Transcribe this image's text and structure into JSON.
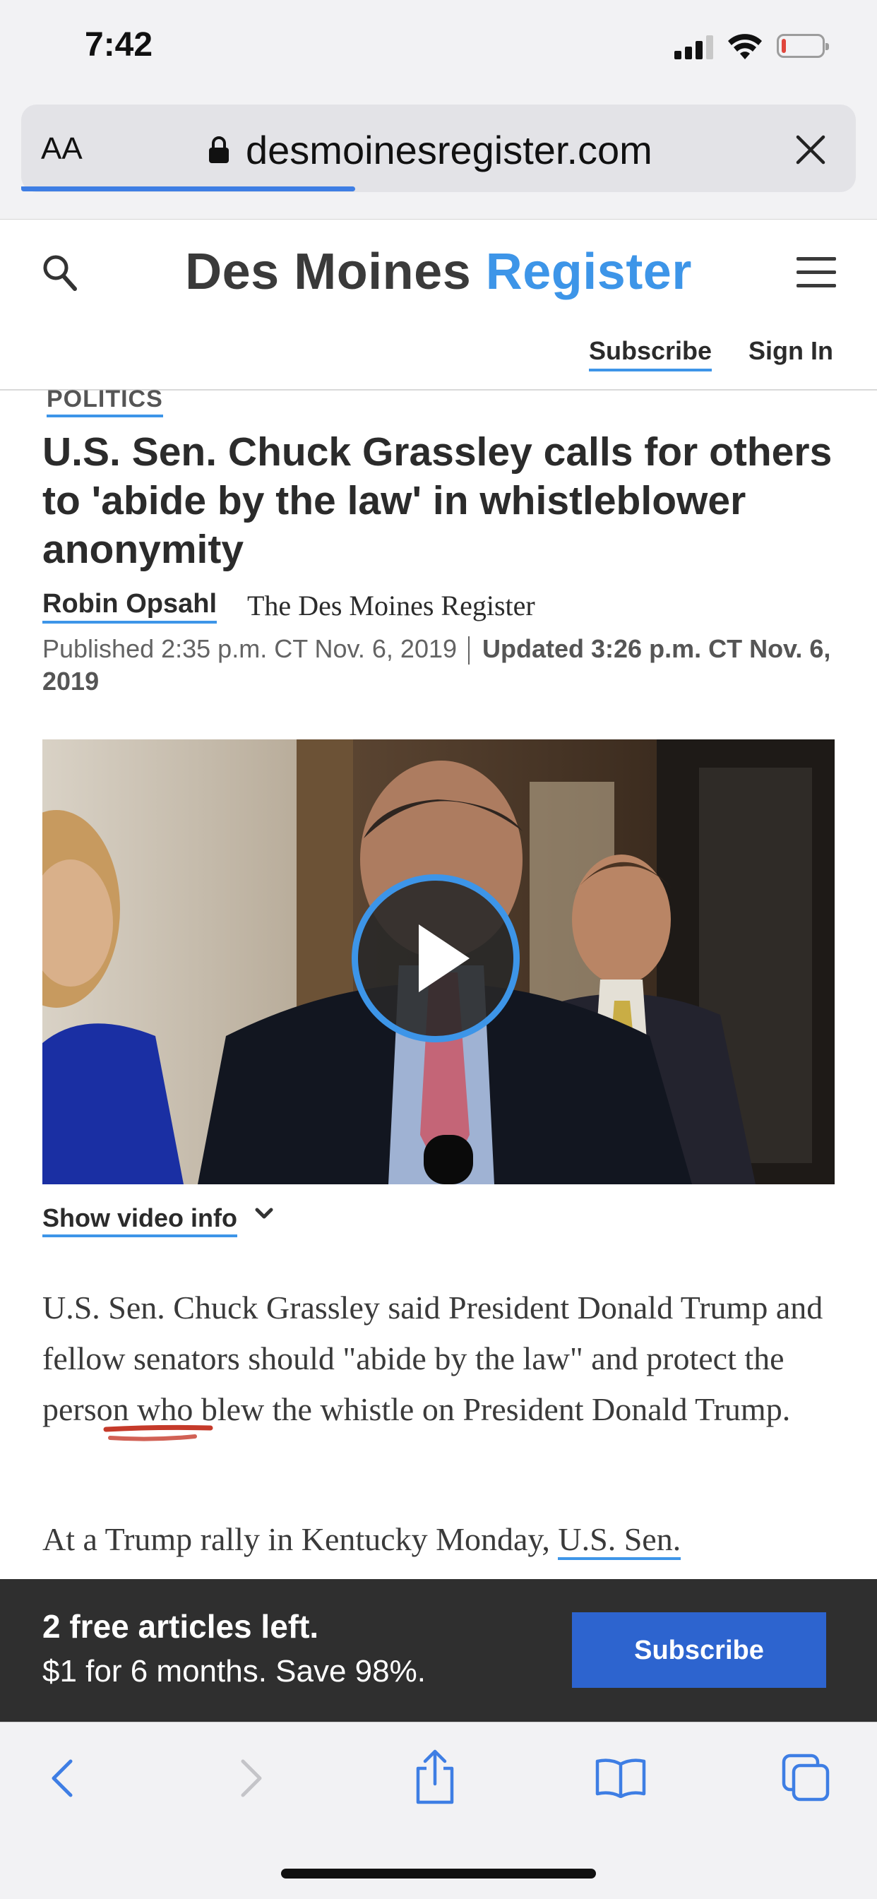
{
  "status_bar": {
    "time": "7:42"
  },
  "browser": {
    "text_size_label": "AA",
    "url": "desmoinesregister.com",
    "load_progress": 0.4
  },
  "site": {
    "name_part1": "Des Moines",
    "name_part2": "Register",
    "subscribe": "Subscribe",
    "sign_in": "Sign In",
    "colors": {
      "brand_blue": "#3d95e8",
      "button_blue": "#2d64cf"
    }
  },
  "article": {
    "section": "POLITICS",
    "headline": "U.S. Sen. Chuck Grassley calls for others to 'abide by the law' in whistleblower anonymity",
    "author": "Robin Opsahl",
    "publication": "The Des Moines Register",
    "published": "Published 2:35 p.m. CT Nov. 6, 2019",
    "updated": "Updated 3:26 p.m. CT Nov. 6, 2019",
    "video_info": "Show video info",
    "para1": "U.S. Sen. Chuck Grassley said President Donald Trump and fellow senators should \"abide by the law\" and protect the person who blew the whistle on President Donald Trump.",
    "para2_start": "At a Trump rally in Kentucky Monday, ",
    "para2_link": "U.S. Sen."
  },
  "paywall": {
    "title": "2 free articles left.",
    "offer": "$1 for 6 months. Save 98%.",
    "button": "Subscribe"
  },
  "toolbar": {
    "icons": [
      "back-icon",
      "forward-icon",
      "share-icon",
      "bookmarks-icon",
      "tabs-icon"
    ]
  }
}
